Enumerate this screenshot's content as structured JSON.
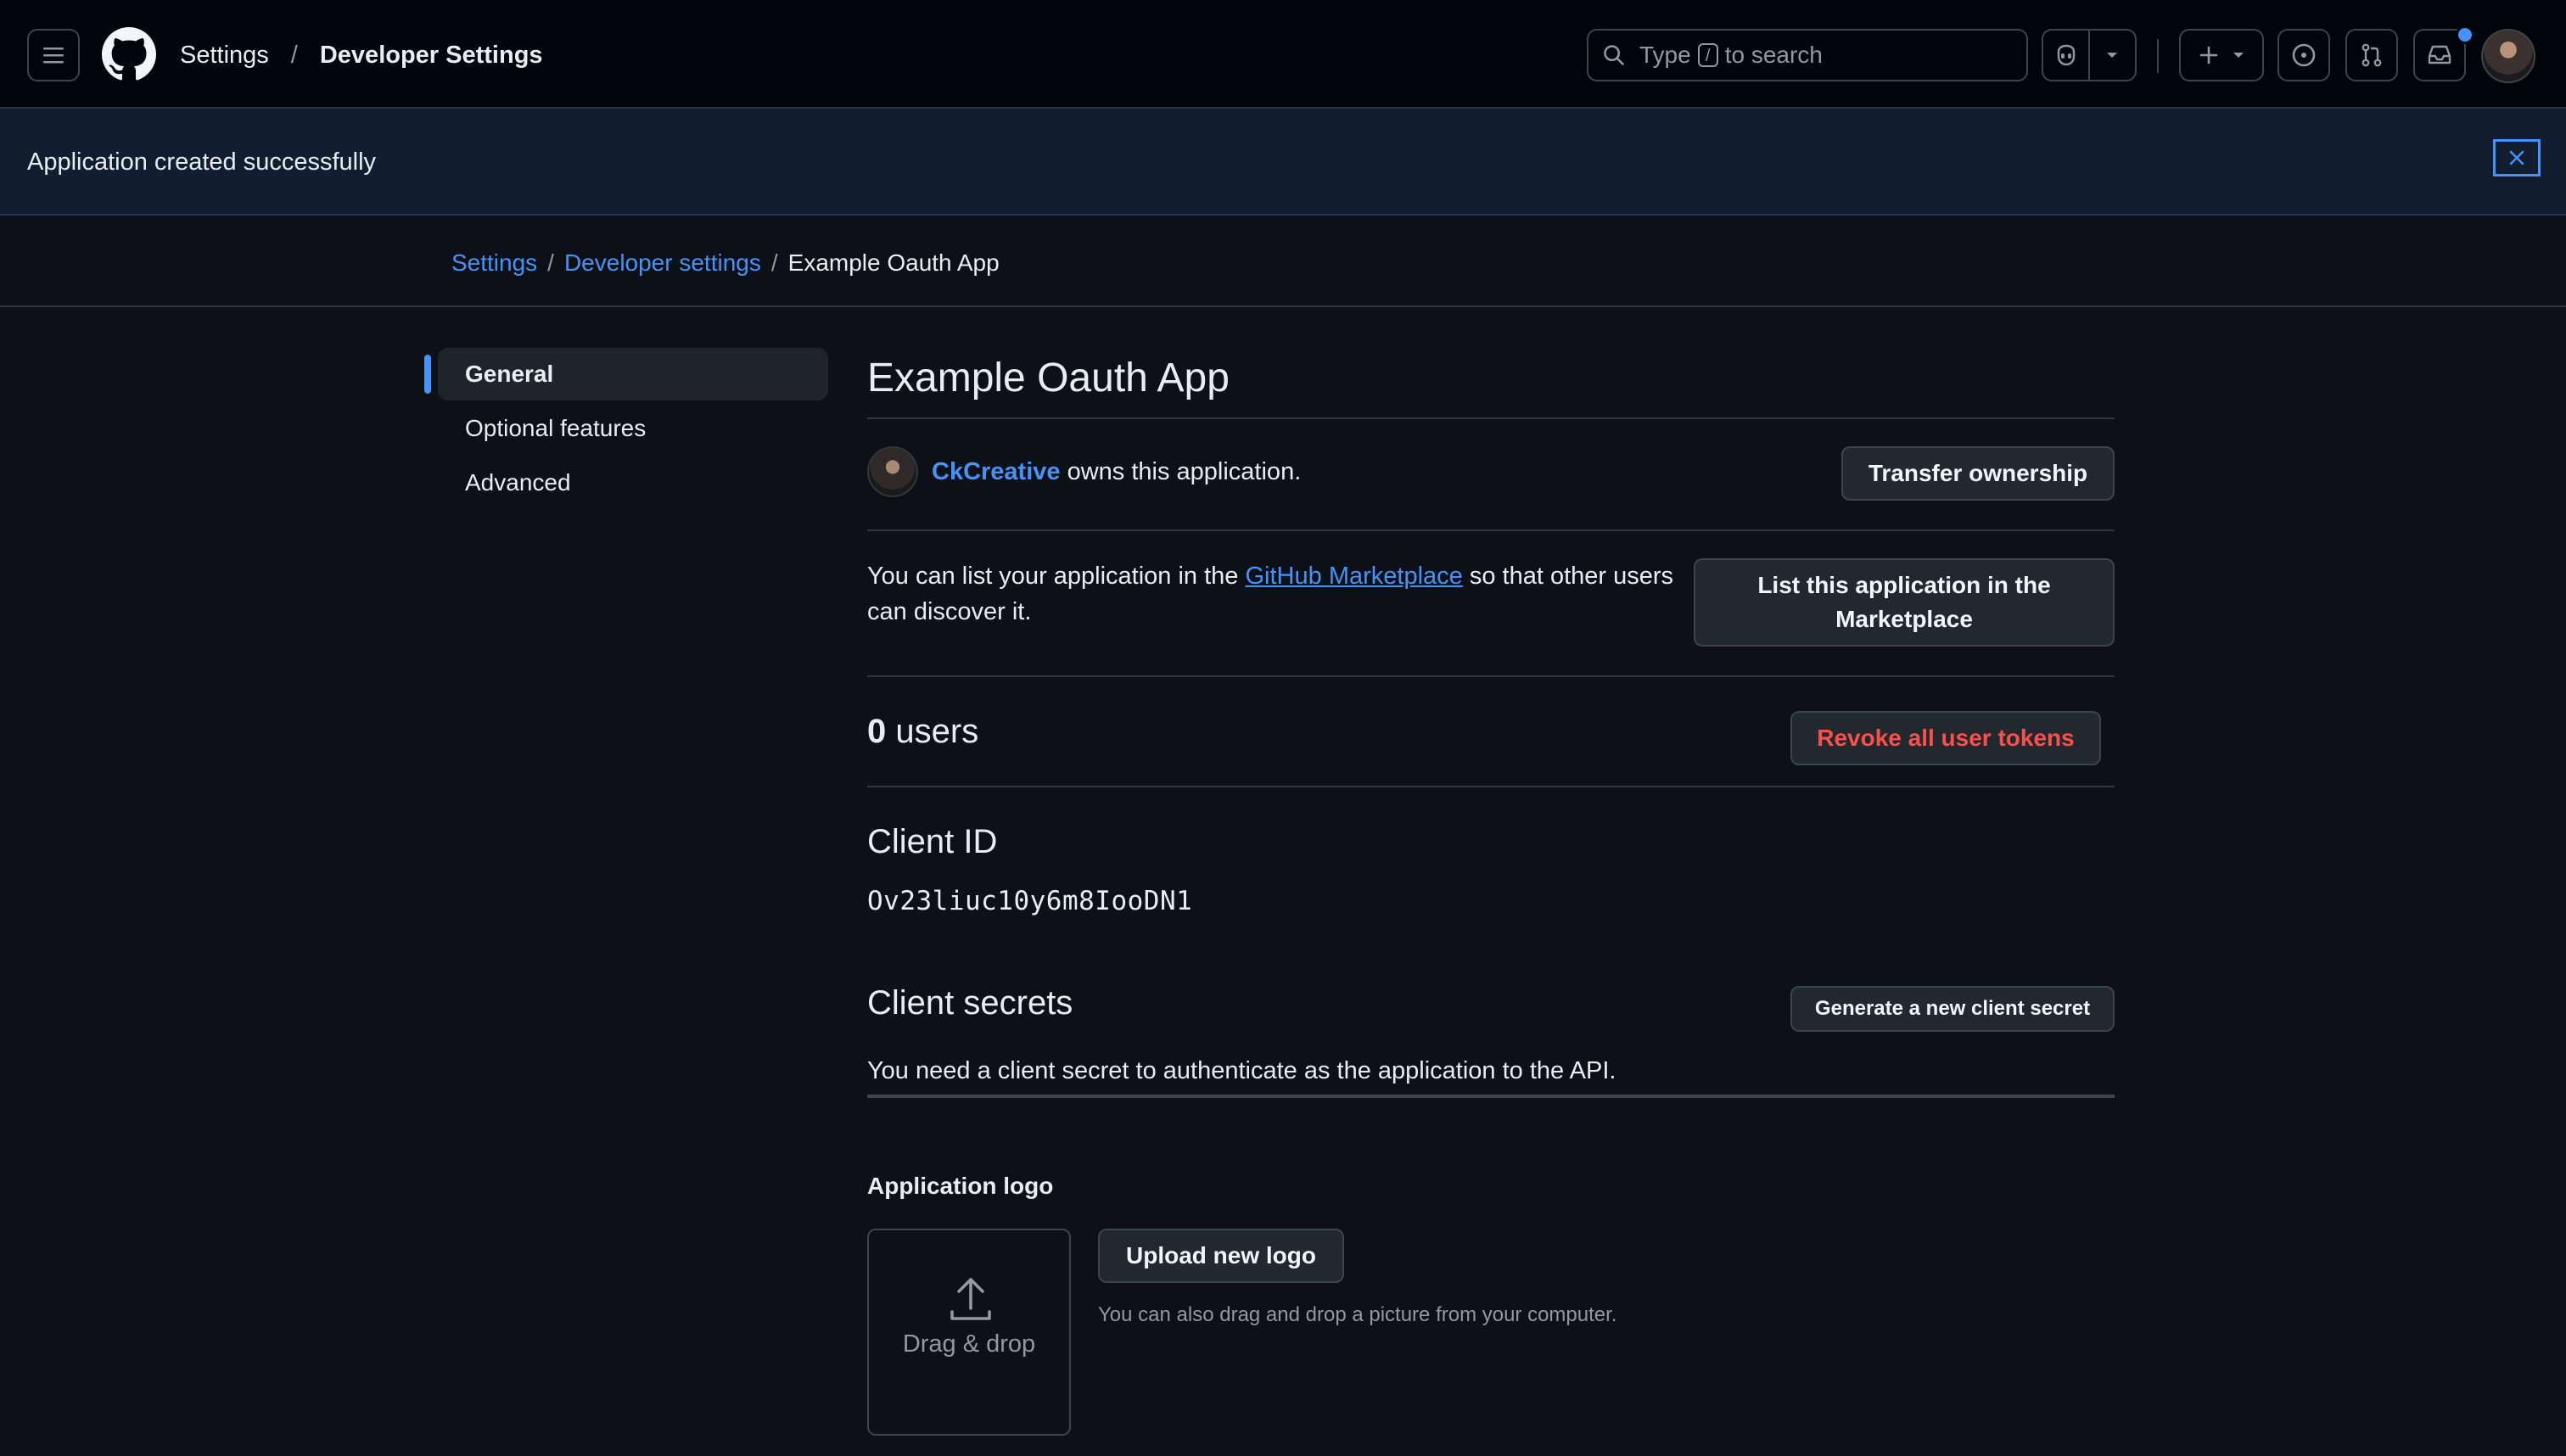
{
  "header": {
    "context_root": "Settings",
    "context_separator": "/",
    "context_current": "Developer Settings",
    "search_prefix": "Type",
    "search_key": "/",
    "search_suffix": "to search"
  },
  "flash": {
    "message": "Application created successfully"
  },
  "breadcrumb": {
    "items": [
      "Settings",
      "Developer settings",
      "Example Oauth App"
    ],
    "separator": "/"
  },
  "sidenav": {
    "items": [
      {
        "label": "General",
        "active": true
      },
      {
        "label": "Optional features",
        "active": false
      },
      {
        "label": "Advanced",
        "active": false
      }
    ]
  },
  "main": {
    "title": "Example Oauth App",
    "owner": {
      "username": "CkCreative",
      "suffix": "owns this application.",
      "transfer_label": "Transfer ownership"
    },
    "marketplace": {
      "text_before": "You can list your application in the",
      "link": "GitHub Marketplace",
      "text_after": "so that other users can discover it.",
      "button_label": "List this application in the Marketplace"
    },
    "users": {
      "count": "0",
      "label": "users",
      "revoke_label": "Revoke all user tokens"
    },
    "client_id": {
      "heading": "Client ID",
      "value": "Ov23liuc10y6m8IooDN1"
    },
    "client_secrets": {
      "heading": "Client secrets",
      "generate_label": "Generate a new client secret",
      "description": "You need a client secret to authenticate as the application to the API."
    },
    "logo": {
      "heading": "Application logo",
      "dropzone_text": "Drag & drop",
      "upload_label": "Upload new logo",
      "hint": "You can also drag and drop a picture from your computer."
    }
  },
  "colors": {
    "background": "#0d1117",
    "header_bg": "#010409",
    "flash_bg": "#121d2f",
    "accent": "#4493f8",
    "danger": "#f85149",
    "border": "#3d444d"
  }
}
